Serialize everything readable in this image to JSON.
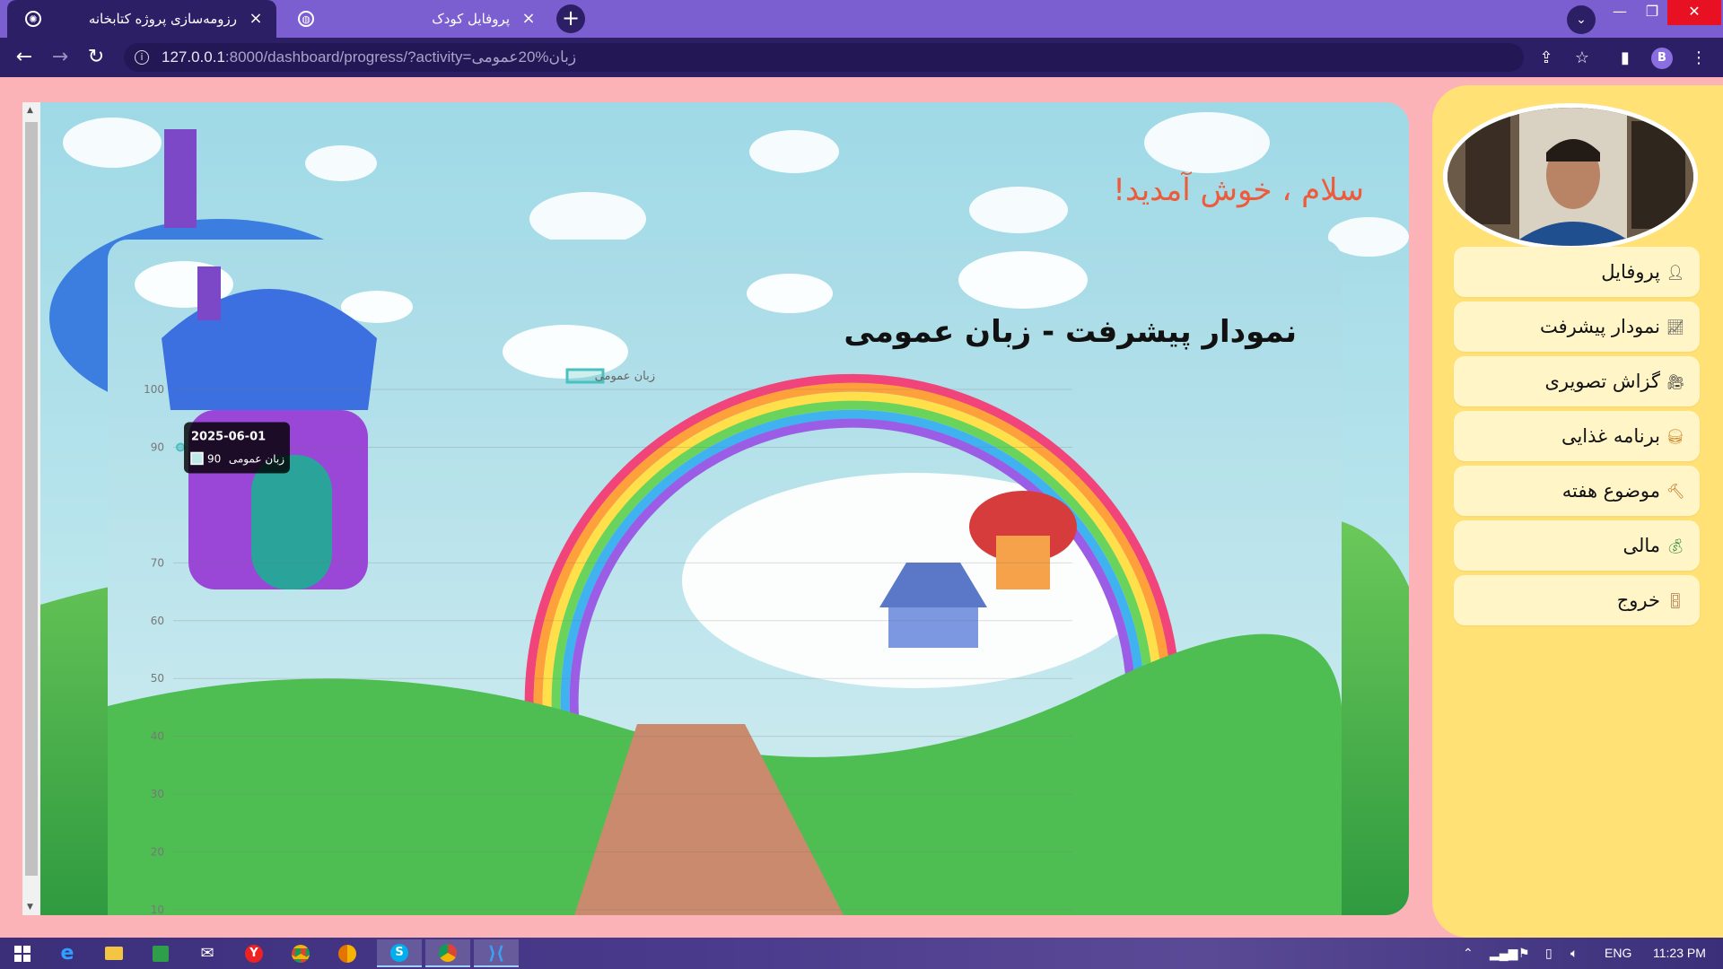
{
  "browser": {
    "tabs": [
      {
        "title": "رزومه‌سازی پروژه کتابخانه",
        "active": true
      },
      {
        "title": "پروفایل کودک",
        "active": false
      }
    ],
    "url_host": "127.0.0.1",
    "url_rest": ":8000/dashboard/progress/?activity=زبان%20عمومی",
    "profile_initial": "B"
  },
  "page": {
    "greeting": "سلام ، خوش آمدید!"
  },
  "chart_data": {
    "type": "line",
    "title": "نمودار پیشرفت - زبان عمومی",
    "legend": [
      "زبان عمومی"
    ],
    "legend_position": "top-center",
    "xlabel": "",
    "ylabel": "",
    "ylim": [
      10,
      100
    ],
    "yticks": [
      100,
      90,
      70,
      60,
      50,
      40,
      30,
      20,
      10
    ],
    "grid": true,
    "series": [
      {
        "name": "زبان عمومی",
        "color": "#4bc0c0",
        "x": [
          "2025-06-01"
        ],
        "values": [
          90
        ]
      }
    ],
    "tooltip": {
      "date": "2025-06-01",
      "label": "زبان عمومی",
      "value": "90"
    }
  },
  "sidebar": {
    "items": [
      {
        "label": "پروفایل",
        "icon": "person-icon"
      },
      {
        "label": "نمودار پیشرفت",
        "icon": "chart-icon"
      },
      {
        "label": "گزاش تصویری",
        "icon": "video-camera-icon"
      },
      {
        "label": "برنامه غذایی",
        "icon": "burger-icon"
      },
      {
        "label": "موضوع هفته",
        "icon": "hammer-icon"
      },
      {
        "label": "مالی",
        "icon": "money-bag-icon"
      },
      {
        "label": "خروج",
        "icon": "door-icon"
      }
    ]
  },
  "taskbar": {
    "language": "ENG",
    "time": "11:23 PM"
  }
}
